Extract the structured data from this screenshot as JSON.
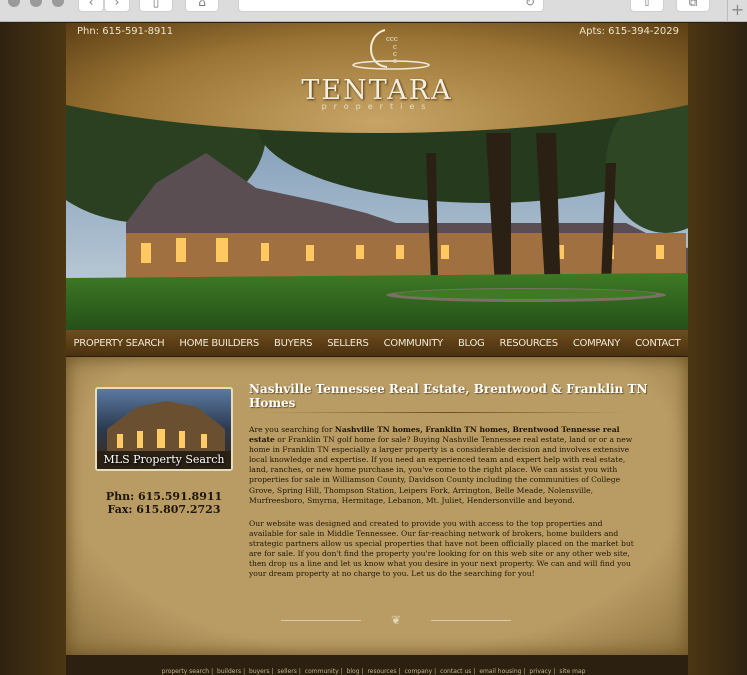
{
  "browser": {
    "back": "‹",
    "forward": "›",
    "plus": "+"
  },
  "header": {
    "phone_left": "Phn: 615-591-8911",
    "phone_right": "Apts: 615-394-2029",
    "logo": "TENTARA",
    "logo_sub": "properties"
  },
  "nav": [
    "PROPERTY SEARCH",
    "HOME BUILDERS",
    "BUYERS",
    "SELLERS",
    "COMMUNITY",
    "BLOG",
    "RESOURCES",
    "COMPANY",
    "CONTACT"
  ],
  "sidebar": {
    "mls_label": "MLS Property Search",
    "phone": "Phn: 615.591.8911",
    "fax": "Fax: 615.807.2723"
  },
  "main": {
    "title": "Nashville Tennessee Real Estate, Brentwood & Franklin TN Homes",
    "p1_pre": "Are you searching for ",
    "p1_bold": "Nashville TN homes, Franklin TN homes, Brentwood Tennesse real estate",
    "p1_post": " or Franklin TN golf home for sale? Buying Nashville Tennessee real estate, land or or a new home in Franklin TN especially a larger property is a considerable decision and involves extensive local knowledge and expertise. If you need an experienced team and expert help with real estate, land, ranches, or new home purchase in, you've come to the right place. We can assist you with properties for sale in Williamson County, Davidson County including the communities of College Grove, Spring Hill, Thompson Station, Leipers Fork, Arrington, Belle Meade, Nolensville, Murfreesboro, Smyrna, Hermitage, Lebanon, Mt. Juliet, Hendersonville and beyond.",
    "p2": "Our website was designed and created to provide you with access to the top properties and available for sale in Middle Tennessee. Our far-reaching network of brokers, home builders and strategic partners allow us special properties that have not been officially placed on the market but are for sale. If you don't find the property you're looking for on this web site or any other web site, then drop us a line and let us know what you desire in your next property. We can and will find you your dream property at no charge to you. Let us do the searching for you!"
  },
  "footer": [
    "property search",
    "builders",
    "buyers",
    "sellers",
    "community",
    "blog",
    "resources",
    "company",
    "contact us",
    "email housing",
    "privacy",
    "site map"
  ],
  "colors": {
    "accent": "#b99c64",
    "nav": "#5a3e16",
    "bg": "#2c2110"
  }
}
